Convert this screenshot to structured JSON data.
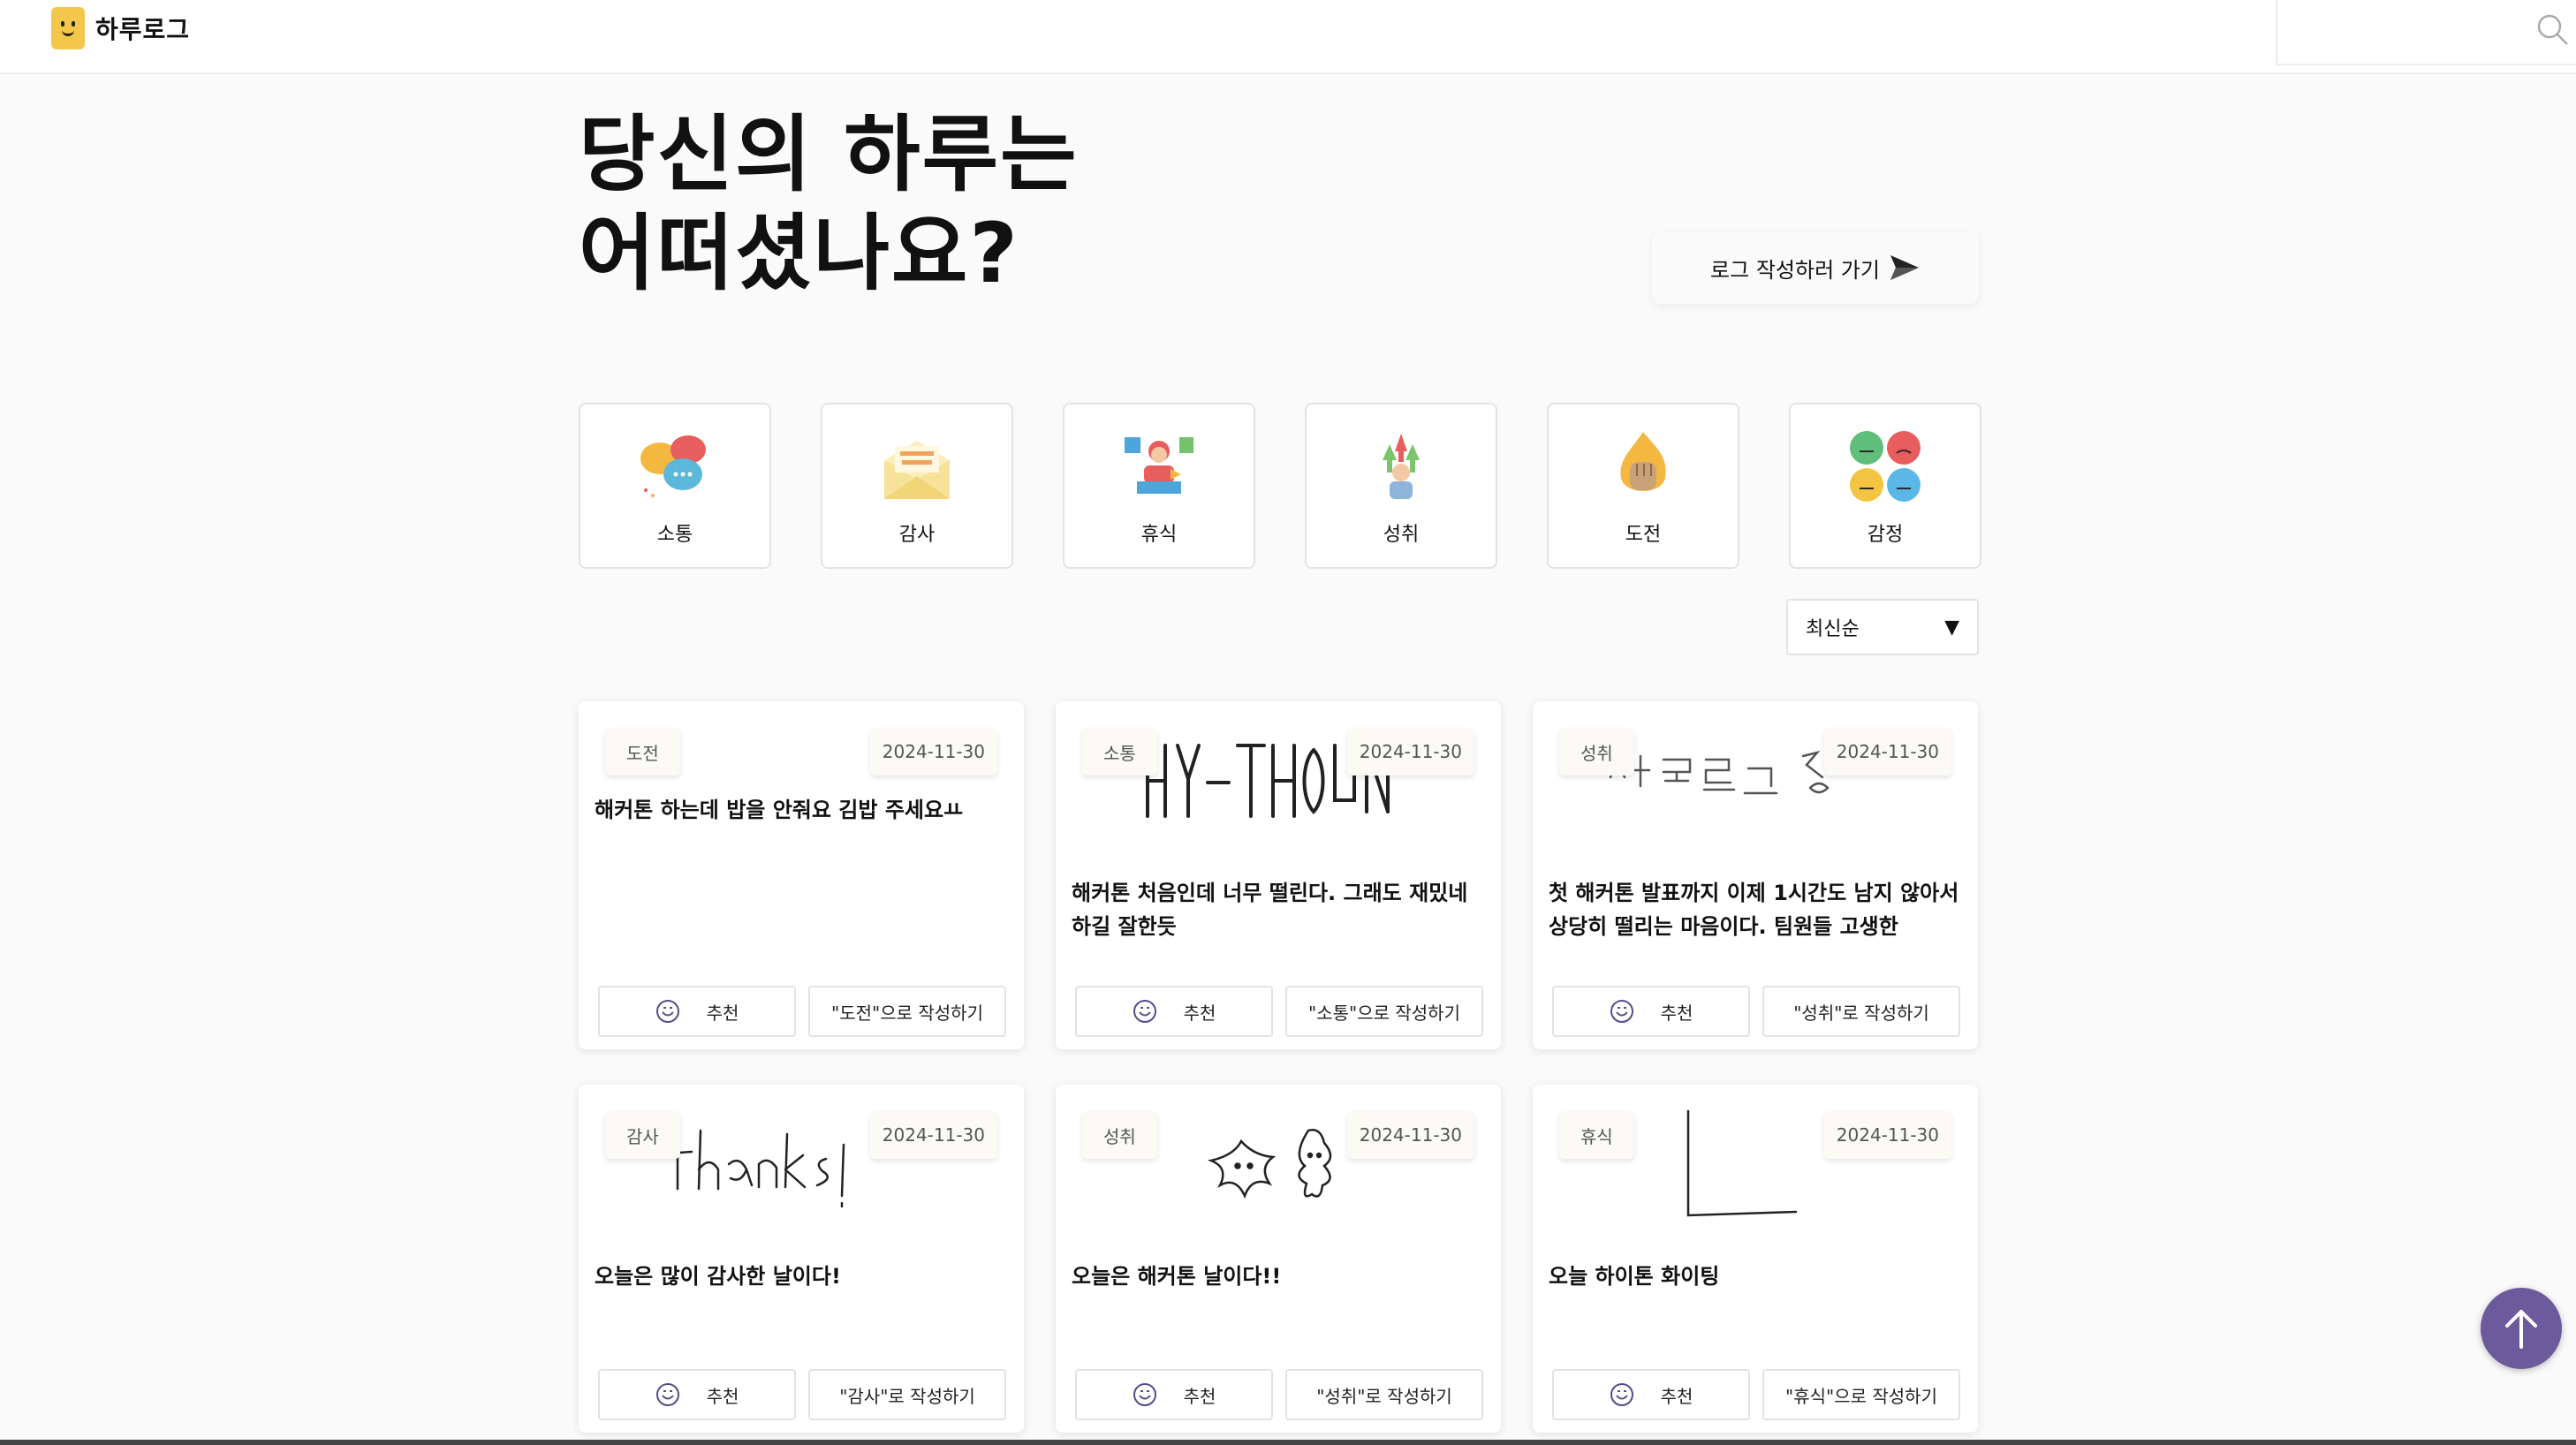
{
  "header": {
    "logo_text": "하루로그",
    "search_placeholder": ""
  },
  "hero": {
    "title_line1": "당신의 하루는",
    "title_line2": "어떠셨나요?",
    "write_button": "로그 작성하러 가기"
  },
  "categories": [
    {
      "label": "소통",
      "icon": "speech-bubbles-icon"
    },
    {
      "label": "감사",
      "icon": "thanks-envelope-icon"
    },
    {
      "label": "휴식",
      "icon": "relaxing-person-icon"
    },
    {
      "label": "성취",
      "icon": "achievement-person-icon"
    },
    {
      "label": "도전",
      "icon": "fist-flame-icon"
    },
    {
      "label": "감정",
      "icon": "emotion-faces-icon"
    }
  ],
  "sort": {
    "selected": "최신순"
  },
  "cards": [
    {
      "tag": "도전",
      "date": "2024-11-30",
      "text": "해커톤 하는데 밥을 안줘요 김밥 주세요ㅛ",
      "reco": "추천",
      "write": "\"도전\"으로 작성하기"
    },
    {
      "tag": "소통",
      "date": "2024-11-30",
      "drawing": "HY-THON",
      "text": "해커톤 처음인데 너무 떨린다. 그래도 재밌네 하길 잘한듯",
      "reco": "추천",
      "write": "\"소통\"으로 작성하기"
    },
    {
      "tag": "성취",
      "date": "2024-11-30",
      "drawing": "하루로그 짱",
      "text": "첫 해커톤 발표까지 이제 1시간도 남지 않아서 상당히 떨리는 마음이다. 팀원들 고생한",
      "reco": "추천",
      "write": "\"성취\"로 작성하기"
    },
    {
      "tag": "감사",
      "date": "2024-11-30",
      "drawing": "thanks!",
      "text": "오늘은 많이 감사한 날이다!",
      "reco": "추천",
      "write": "\"감사\"로 작성하기"
    },
    {
      "tag": "성취",
      "date": "2024-11-30",
      "text": "오늘은 해커톤 날이다!!",
      "reco": "추천",
      "write": "\"성취\"로 작성하기"
    },
    {
      "tag": "휴식",
      "date": "2024-11-30",
      "text": "오늘 하이톤 화이팅",
      "reco": "추천",
      "write": "\"휴식\"으로 작성하기"
    }
  ],
  "colors": {
    "accent": "#6b5a9c",
    "logo": "#f3c74a",
    "background": "#fafafa"
  }
}
